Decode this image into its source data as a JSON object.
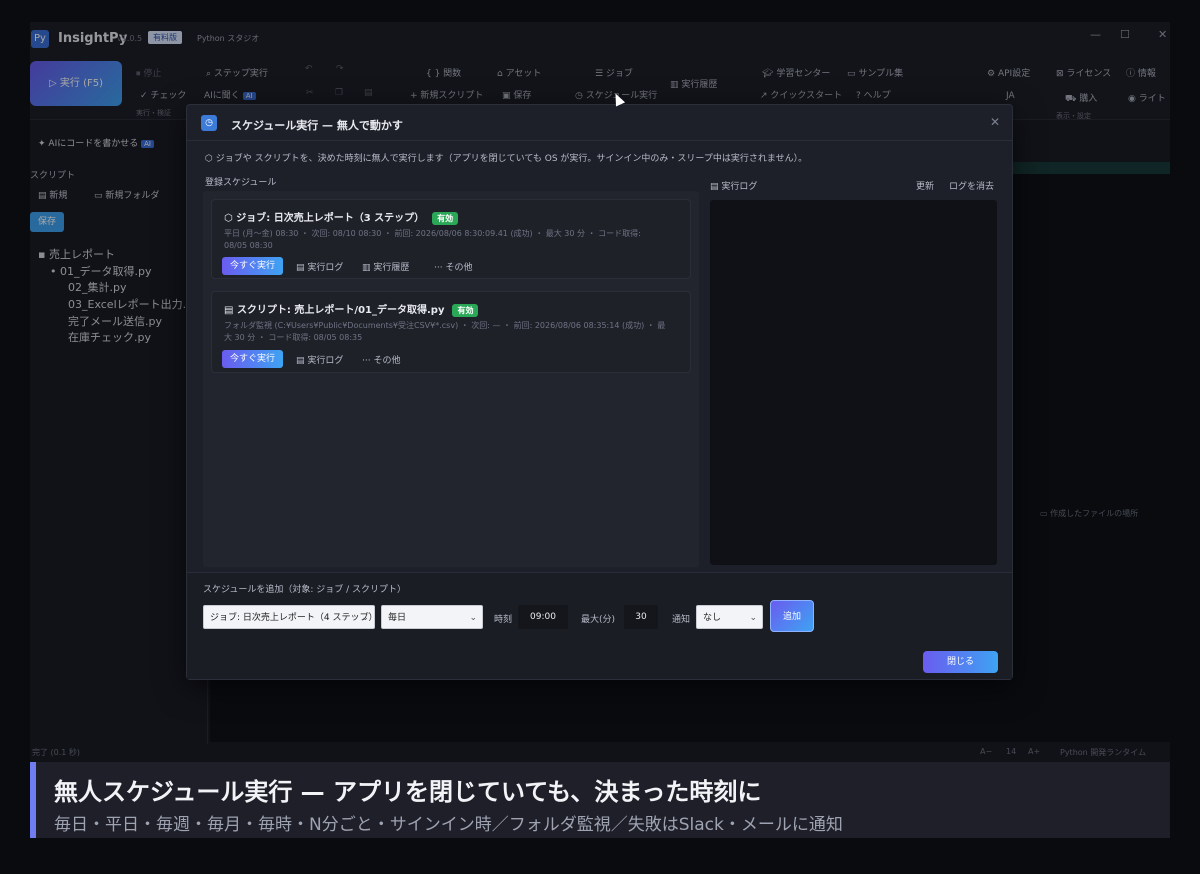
{
  "app": {
    "logo": "Py",
    "title": "InsightPy",
    "version": "v1.0.5",
    "plan_badge": "有料版",
    "subtitle": "Python スタジオ",
    "win_min": "—",
    "win_max": "☐",
    "win_close": "✕"
  },
  "ribbon": {
    "run": "▷ 実行 (F5)",
    "stop": "⏹ 停止",
    "check": "✓ チェック",
    "group_run": "実行・検証",
    "step_run": "⌕ ステップ実行",
    "ask_ai": "AIに聞く",
    "ai_badge": "AI",
    "functions": "{ } 関数",
    "assets": "⌂ アセット",
    "jobs": "☰ ジョブ",
    "new_script": "+ 新規スクリプト",
    "save": "▣ 保存",
    "schedule_run": "◷ スケジュール実行",
    "run_history": "▥ 実行履歴",
    "learning_center": "学習センター",
    "samples": "サンプル集",
    "quick_start": "クイックスタート",
    "help": "? ヘルプ",
    "api_settings": "API設定",
    "license": "ライセンス",
    "info": "情報",
    "lang": "JA",
    "purchase": "購入",
    "light": "ライト",
    "group_view": "表示・設定"
  },
  "ai_bar": {
    "label": "AIにコードを書かせる",
    "badge": "AI"
  },
  "sidebar": {
    "heading": "スクリプト",
    "new": "新規",
    "new_folder": "新規フォルダ",
    "save": "保存",
    "folder": "売上レポート",
    "files": [
      "01_データ取得.py",
      "02_集計.py",
      "03_Excelレポート出力.py",
      "完了メール送信.py",
      "在庫チェック.py"
    ]
  },
  "right_panel": {
    "open_folder": "作成したファイルの場所"
  },
  "status": {
    "left": "完了 (0.1 秒)",
    "font_small": "A−",
    "font_size": "14",
    "font_large": "A+",
    "right": "Python 開発ランタイム"
  },
  "modal": {
    "title": "スケジュール実行 — 無人で動かす",
    "description": "ジョブや スクリプトを、決めた時刻に無人で実行します（アプリを閉じていても OS が実行。サインイン中のみ・スリープ中は実行されません）。",
    "registered_label": "登録スケジュール",
    "log_label": "実行ログ",
    "refresh": "更新",
    "clear_log": "ログを消去",
    "cards": [
      {
        "title": "ジョブ: 日次売上レポート（3 ステップ）",
        "status": "有効",
        "meta1": "平日 (月〜金) 08:30 ・ 次回: 08/10 08:30 ・ 前回: 2026/08/06 8:30:09.41 (成功) ・ 最大 30 分 ・ コード取得:",
        "meta2": "08/05 08:30",
        "run_now": "今すぐ実行",
        "log": "実行ログ",
        "history": "実行履歴",
        "more": "··· その他"
      },
      {
        "title": "スクリプト: 売上レポート/01_データ取得.py",
        "status": "有効",
        "meta1": "フォルダ監視 (C:¥Users¥Public¥Documents¥受注CSV¥*.csv) ・ 次回: — ・ 前回: 2026/08/06 08:35:14 (成功) ・ 最",
        "meta2": "大 30 分 ・ コード取得: 08/05 08:35",
        "run_now": "今すぐ実行",
        "log": "実行ログ",
        "more": "··· その他"
      }
    ],
    "add": {
      "heading": "スケジュールを追加（対象: ジョブ / スクリプト）",
      "target": "ジョブ: 日次売上レポート（4 ステップ）",
      "frequency": "毎日",
      "time_label": "時刻",
      "time": "09:00",
      "max_label": "最大(分)",
      "max": "30",
      "notify_label": "通知",
      "notify": "なし",
      "add_button": "追加"
    },
    "close_button": "閉じる"
  },
  "caption": {
    "headline": "無人スケジュール実行 — アプリを閉じていても、決まった時刻に",
    "sub": "毎日・平日・毎週・毎月・毎時・N分ごと・サインイン時／フォルダ監視／失敗はSlack・メールに通知"
  },
  "colors": {
    "accent_start": "#6a5cf0",
    "accent_end": "#3ea3f2",
    "enabled": "#2aa857",
    "background": "#1b1d25"
  }
}
